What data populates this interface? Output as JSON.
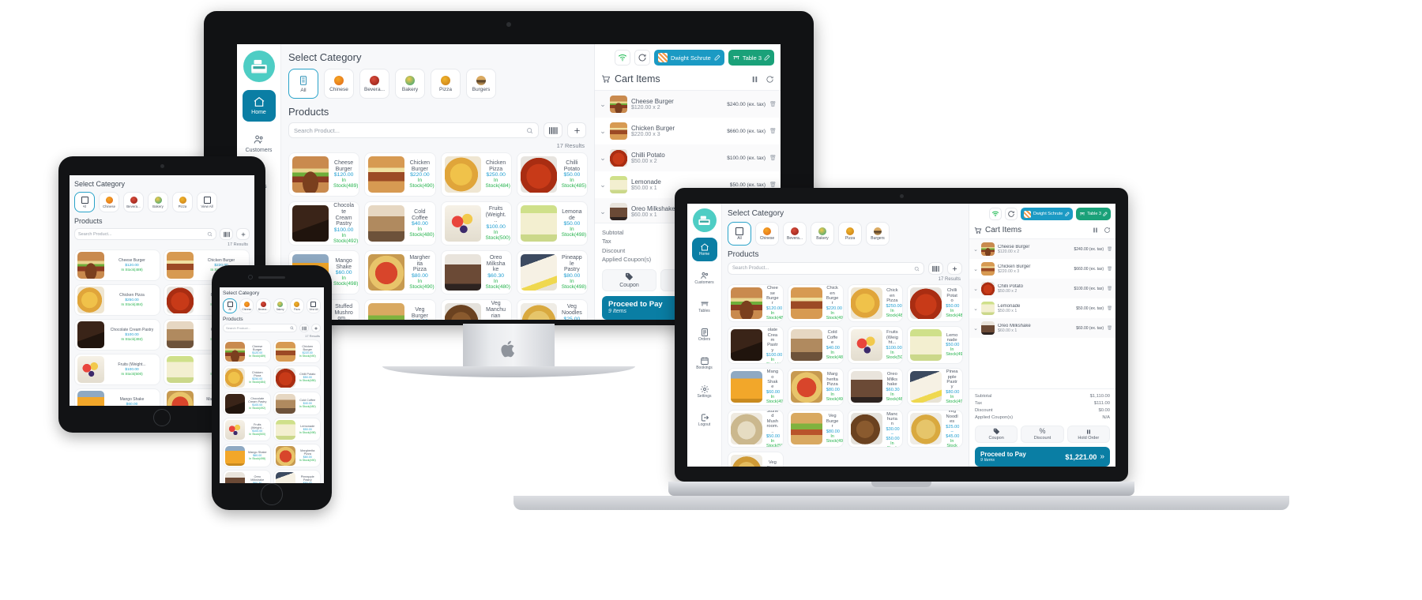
{
  "app": {
    "brand_logo": "cash-register-icon",
    "category_heading": "Select Category",
    "products_heading": "Products",
    "search_placeholder": "Search Product...",
    "barcode_icon": "barcode-icon",
    "add_icon": "plus-icon",
    "results_text": "17 Results",
    "results_text_short": "17 Results"
  },
  "sidebar": {
    "items": [
      {
        "label": "Home",
        "icon": "home-icon",
        "active": true
      },
      {
        "label": "Customers",
        "icon": "customers-icon",
        "active": false
      },
      {
        "label": "Tables",
        "icon": "tables-icon",
        "active": false
      },
      {
        "label": "Orders",
        "icon": "orders-icon",
        "active": false
      },
      {
        "label": "Bookings",
        "icon": "bookings-icon",
        "active": false
      },
      {
        "label": "Settings",
        "icon": "gear-icon",
        "active": false
      },
      {
        "label": "Logout",
        "icon": "logout-icon",
        "active": false
      }
    ]
  },
  "categories": [
    {
      "label": "All",
      "icon": "list-icon",
      "active": true
    },
    {
      "label": "Chinese",
      "icon": "chinese-icon",
      "active": false
    },
    {
      "label": "Bevera...",
      "icon": "beverage-icon",
      "active": false
    },
    {
      "label": "Bakery",
      "icon": "bakery-icon",
      "active": false
    },
    {
      "label": "Pizza",
      "icon": "pizza-icon",
      "active": false
    },
    {
      "label": "Burgers",
      "icon": "burger-icon",
      "active": false
    }
  ],
  "categories_tablet": [
    {
      "label": "All",
      "icon": "list-icon",
      "active": true
    },
    {
      "label": "Chinese",
      "icon": "chinese-icon",
      "active": false
    },
    {
      "label": "Bevera...",
      "icon": "beverage-icon",
      "active": false
    },
    {
      "label": "Bakery",
      "icon": "bakery-icon",
      "active": false
    },
    {
      "label": "Pizza",
      "icon": "pizza-icon",
      "active": false
    },
    {
      "label": "View All",
      "icon": "grid-icon",
      "active": false
    }
  ],
  "products": [
    {
      "name": "Cheese Burger",
      "price": "$120.00",
      "stock": "In Stock(489)",
      "img": "img-cheeseburger"
    },
    {
      "name": "Chicken Burger",
      "price": "$220.00",
      "stock": "In Stock(490)",
      "img": "img-chickenburger"
    },
    {
      "name": "Chicken Pizza",
      "price": "$250.00",
      "stock": "In Stock(484)",
      "img": "img-chickenpizza"
    },
    {
      "name": "Chilli Potato",
      "price": "$50.00",
      "stock": "In Stock(485)",
      "img": "img-chillipotato"
    },
    {
      "name": "Chocolate Cream Pastry",
      "price": "$100.00",
      "stock": "In Stock(492)",
      "img": "img-chocopastry"
    },
    {
      "name": "Cold Coffee",
      "price": "$40.00",
      "stock": "In Stock(480)",
      "img": "img-coldcoffee"
    },
    {
      "name": "Fruits (Weight...",
      "price": "$100.00",
      "stock": "In Stock(500)",
      "img": "img-fruits"
    },
    {
      "name": "Lemonade",
      "price": "$50.00",
      "stock": "In Stock(498)",
      "img": "img-lemonade"
    },
    {
      "name": "Mango Shake",
      "price": "$60.00",
      "stock": "In Stock(498)",
      "img": "img-mangoshake"
    },
    {
      "name": "Margherita Pizza",
      "price": "$80.00",
      "stock": "In Stock(490)",
      "img": "img-margherita"
    },
    {
      "name": "Oreo Milkshake",
      "price": "$60.30",
      "stock": "In Stock(480)",
      "img": "img-oreoshake"
    },
    {
      "name": "Pineapple Pastry",
      "price": "$80.00",
      "stock": "In Stock(498)",
      "img": "img-pineapple"
    },
    {
      "name": "Stuffed Mushroom...",
      "price": "$50.00",
      "stock": "In Stock(588)",
      "img": "img-stuffedmush"
    },
    {
      "name": "Veg Burger",
      "price": "$80.00",
      "stock": "In Stock(495)",
      "img": "img-vegburger"
    },
    {
      "name": "Veg Manchurian",
      "price": "$30.00 – $50.00",
      "stock": "In Stock",
      "img": "img-vegmanchurian"
    },
    {
      "name": "Veg Noodles",
      "price": "$25.00 – $45.00",
      "stock": "In Stock",
      "img": "img-vegnoodles"
    },
    {
      "name": "Veg Singapore...",
      "price": "",
      "stock": "",
      "img": "img-vegsingapore"
    }
  ],
  "topbar": {
    "wifi_icon": "wifi-icon",
    "sync_icon": "sync-icon",
    "customer_name": "Dwight Schrute",
    "customer_edit_icon": "pencil-icon",
    "customer_avatar": "avatar-icon",
    "table_label": "Table 3",
    "table_icon": "table-icon",
    "table_edit_icon": "pencil-icon"
  },
  "cart": {
    "title": "Cart Items",
    "cart_icon": "cart-icon",
    "pause_icon": "pause-icon",
    "refresh_icon": "refresh-icon",
    "delete_icon": "trash-icon",
    "chevron_icon": "chevron-down-icon",
    "items": [
      {
        "name": "Cheese Burger",
        "qty": "$120.00 x 2",
        "amount": "$240.00 (ex. tax)",
        "img": "img-cheeseburger"
      },
      {
        "name": "Chicken Burger",
        "qty": "$220.00 x 3",
        "amount": "$660.00 (ex. tax)",
        "img": "img-chickenburger"
      },
      {
        "name": "Chilli Potato",
        "qty": "$50.00 x 2",
        "amount": "$100.00 (ex. tax)",
        "img": "img-chillipotato"
      },
      {
        "name": "Lemonade",
        "qty": "$50.00 x 1",
        "amount": "$50.00 (ex. tax)",
        "img": "img-lemonade"
      },
      {
        "name": "Oreo Milkshake",
        "qty": "$60.00 x 1",
        "amount": "$60.00 (ex. tax)",
        "img": "img-oreoshake"
      }
    ],
    "totals": [
      {
        "label": "Subtotal",
        "value": "$1,110.00"
      },
      {
        "label": "Tax",
        "value": "$111.00"
      },
      {
        "label": "Discount",
        "value": "$0.00"
      },
      {
        "label": "Applied Coupon(s)",
        "value": "N/A"
      }
    ],
    "actions": [
      {
        "label": "Coupon",
        "icon": "tag-icon"
      },
      {
        "label": "Discount",
        "icon": "percent-icon"
      },
      {
        "label": "Hold Order",
        "icon": "pause-icon"
      }
    ],
    "pay_label": "Proceed to Pay",
    "pay_sub": "9 Items",
    "pay_total": "$1,221.00",
    "pay_arrow": "double-chevron-right-icon"
  }
}
